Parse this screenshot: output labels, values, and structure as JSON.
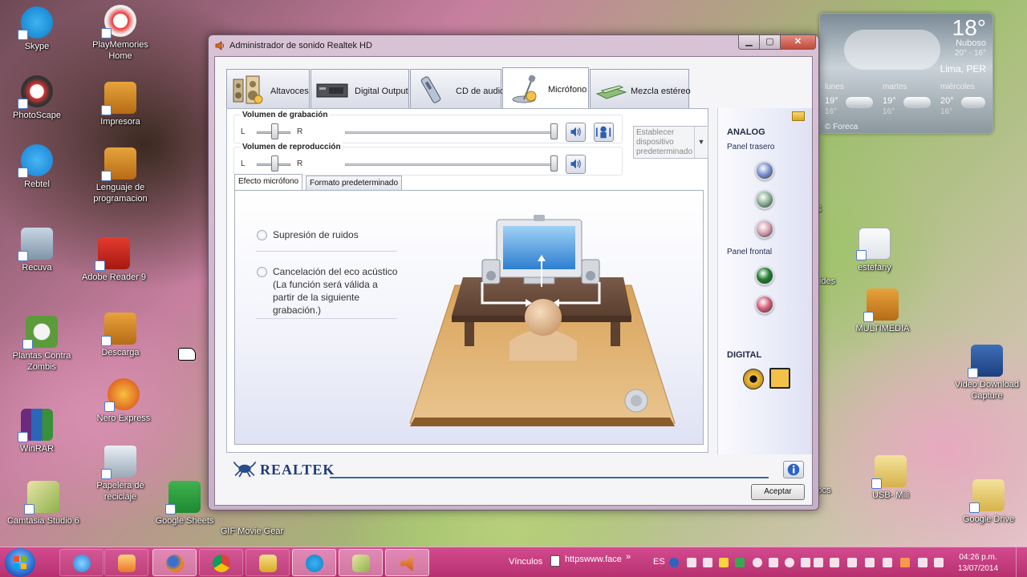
{
  "desktop": {
    "left_icons": [
      {
        "label": "Skype"
      },
      {
        "label": "PhotoScape"
      },
      {
        "label": "Rebtel"
      },
      {
        "label": "Recuva"
      },
      {
        "label": "Plantas Contra Zombis"
      },
      {
        "label": "WinRAR"
      },
      {
        "label": "Camtasia Studio 6"
      }
    ],
    "second_icons": [
      {
        "label": "PlayMemories Home"
      },
      {
        "label": "Impresora"
      },
      {
        "label": "Lenguaje de programacion"
      },
      {
        "label": "Adobe Reader 9"
      },
      {
        "label": "Descarga"
      },
      {
        "label": "Nero Express"
      },
      {
        "label": "Papelera de reciclaje"
      }
    ],
    "bottom_icons": [
      {
        "label": "Google Sheets"
      },
      {
        "label": "GIF Movie Gear"
      }
    ],
    "right_icons": [
      {
        "label": "estefany"
      },
      {
        "label": "MULTIMEDIA"
      },
      {
        "label": "Video Download Capture"
      },
      {
        "label": "USB- Mili"
      },
      {
        "label": "Google Drive"
      }
    ],
    "partial_labels": {
      "c": "C",
      "ides": "ides",
      "ocs": "ocs"
    }
  },
  "window": {
    "title": "Administrador de sonido Realtek HD",
    "device_tabs": [
      {
        "label": "Altavoces",
        "icon": "speakers-icon"
      },
      {
        "label": "Digital Output",
        "icon": "digital-output-icon"
      },
      {
        "label": "CD de audio",
        "icon": "cd-audio-icon"
      },
      {
        "label": "Micrófono",
        "icon": "microphone-icon",
        "active": true
      },
      {
        "label": "Mezcla estéreo",
        "icon": "stereo-mix-icon"
      }
    ],
    "recording_volume": {
      "title": "Volumen de grabación",
      "left": "L",
      "right": "R",
      "level": 1.0
    },
    "playback_volume": {
      "title": "Volumen de reproducción",
      "left": "L",
      "right": "R",
      "level": 1.0
    },
    "set_default_device": "Establecer dispositivo predeterminado",
    "sub_tabs": [
      {
        "label": "Efecto micrófono",
        "active": true
      },
      {
        "label": "Formato predeterminado"
      }
    ],
    "effects": [
      {
        "label": "Supresión de ruidos",
        "checked": false
      },
      {
        "label": "Cancelación del eco acústico",
        "note": [
          "(La función será válida a",
          "partir de la siguiente",
          "grabación.)"
        ],
        "checked": false
      }
    ],
    "jack_panel": {
      "analog_title": "ANALOG",
      "rear_title": "Panel trasero",
      "front_title": "Panel frontal",
      "digital_title": "DIGITAL",
      "rear_jacks": [
        "#7f95d4",
        "#8fb59a",
        "#d9a3b5"
      ],
      "front_jacks": [
        "#1f7f2c",
        "#d7607a"
      ]
    },
    "brand": "REALTEK",
    "accept": "Aceptar"
  },
  "weather": {
    "temperature": "18°",
    "condition": "Nuboso",
    "range": "20° - 16°",
    "city": "Lima, PER",
    "forecast": [
      {
        "day": "lunes",
        "hi": "19°",
        "lo": "16°"
      },
      {
        "day": "martes",
        "hi": "19°",
        "lo": "16°"
      },
      {
        "day": "miércoles",
        "hi": "20°",
        "lo": "16°"
      }
    ],
    "source": "© Foreca"
  },
  "taskbar": {
    "links_label": "Vínculos",
    "url": "httpswww.face",
    "language": "ES",
    "time": "04:26 p.m.",
    "date": "13/07/2014",
    "buttons": [
      "internet-explorer-icon",
      "media-player-icon",
      "firefox-icon",
      "chrome-icon",
      "file-explorer-icon",
      "skype-icon",
      "camtasia-icon",
      "volume-icon"
    ]
  },
  "colors": {
    "accent_blue": "#1e3b78",
    "taskbar": "#c63d80",
    "title_bar": "#d8c2d5"
  }
}
